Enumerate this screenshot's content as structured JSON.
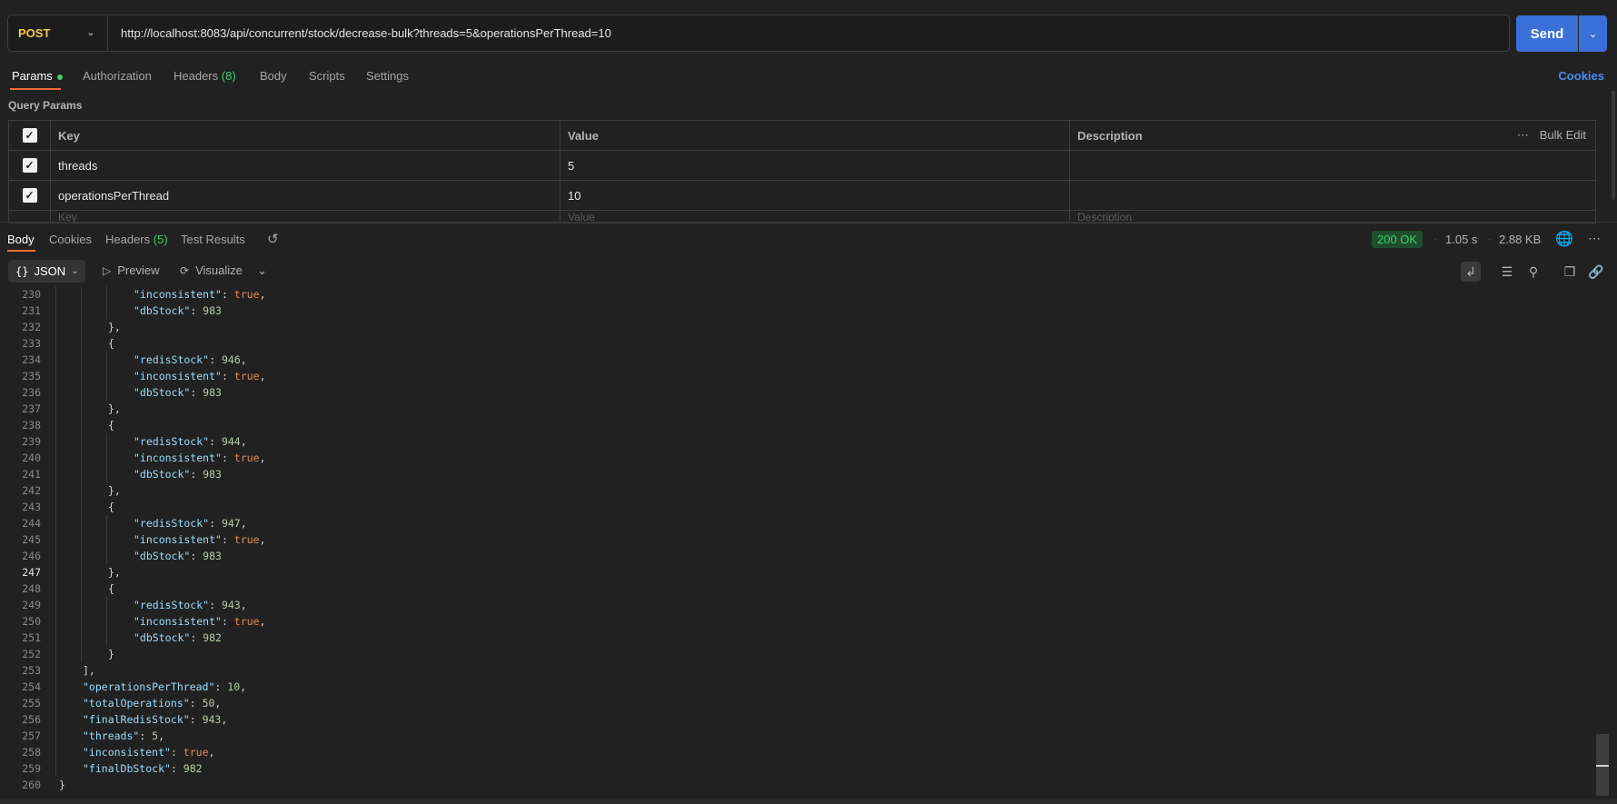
{
  "request": {
    "method": "POST",
    "url": "http://localhost:8083/api/concurrent/stock/decrease-bulk?threads=5&operationsPerThread=10",
    "send_label": "Send"
  },
  "request_tabs": {
    "params": "Params",
    "authorization": "Authorization",
    "headers": "Headers",
    "headers_count": "(8)",
    "body": "Body",
    "scripts": "Scripts",
    "settings": "Settings",
    "cookies": "Cookies"
  },
  "query_params": {
    "title": "Query Params",
    "headers": {
      "key": "Key",
      "value": "Value",
      "description": "Description",
      "bulk_edit": "Bulk Edit"
    },
    "rows": [
      {
        "key": "threads",
        "value": "5",
        "checked": true
      },
      {
        "key": "operationsPerThread",
        "value": "10",
        "checked": true
      }
    ],
    "placeholders": {
      "key": "Key",
      "value": "Value",
      "description": "Description"
    }
  },
  "response_tabs": {
    "body": "Body",
    "cookies": "Cookies",
    "headers": "Headers",
    "headers_count": "(5)",
    "test_results": "Test Results",
    "status": "200 OK",
    "time": "1.05 s",
    "size": "2.88 KB"
  },
  "response_toolbar": {
    "format": "JSON",
    "preview": "Preview",
    "visualize": "Visualize"
  },
  "colors": {
    "accent_orange": "#f26b3a",
    "send_blue": "#3b6fd8",
    "success_green": "#3ecf6e",
    "method_yellow": "#f2c94c"
  },
  "code_lines": [
    {
      "n": "230",
      "indent": 3,
      "parts": [
        [
          "k",
          "\"inconsistent\""
        ],
        [
          "p",
          ": "
        ],
        [
          "b",
          "true"
        ],
        [
          "p",
          ","
        ]
      ]
    },
    {
      "n": "231",
      "indent": 3,
      "parts": [
        [
          "k",
          "\"dbStock\""
        ],
        [
          "p",
          ": "
        ],
        [
          "n",
          "983"
        ]
      ]
    },
    {
      "n": "232",
      "indent": 2,
      "parts": [
        [
          "p",
          "},"
        ]
      ]
    },
    {
      "n": "233",
      "indent": 2,
      "parts": [
        [
          "p",
          "{"
        ]
      ]
    },
    {
      "n": "234",
      "indent": 3,
      "parts": [
        [
          "k",
          "\"redisStock\""
        ],
        [
          "p",
          ": "
        ],
        [
          "n",
          "946"
        ],
        [
          "p",
          ","
        ]
      ]
    },
    {
      "n": "235",
      "indent": 3,
      "parts": [
        [
          "k",
          "\"inconsistent\""
        ],
        [
          "p",
          ": "
        ],
        [
          "b",
          "true"
        ],
        [
          "p",
          ","
        ]
      ]
    },
    {
      "n": "236",
      "indent": 3,
      "parts": [
        [
          "k",
          "\"dbStock\""
        ],
        [
          "p",
          ": "
        ],
        [
          "n",
          "983"
        ]
      ]
    },
    {
      "n": "237",
      "indent": 2,
      "parts": [
        [
          "p",
          "},"
        ]
      ]
    },
    {
      "n": "238",
      "indent": 2,
      "parts": [
        [
          "p",
          "{"
        ]
      ]
    },
    {
      "n": "239",
      "indent": 3,
      "parts": [
        [
          "k",
          "\"redisStock\""
        ],
        [
          "p",
          ": "
        ],
        [
          "n",
          "944"
        ],
        [
          "p",
          ","
        ]
      ]
    },
    {
      "n": "240",
      "indent": 3,
      "parts": [
        [
          "k",
          "\"inconsistent\""
        ],
        [
          "p",
          ": "
        ],
        [
          "b",
          "true"
        ],
        [
          "p",
          ","
        ]
      ]
    },
    {
      "n": "241",
      "indent": 3,
      "parts": [
        [
          "k",
          "\"dbStock\""
        ],
        [
          "p",
          ": "
        ],
        [
          "n",
          "983"
        ]
      ]
    },
    {
      "n": "242",
      "indent": 2,
      "parts": [
        [
          "p",
          "},"
        ]
      ]
    },
    {
      "n": "243",
      "indent": 2,
      "parts": [
        [
          "p",
          "{"
        ]
      ]
    },
    {
      "n": "244",
      "indent": 3,
      "parts": [
        [
          "k",
          "\"redisStock\""
        ],
        [
          "p",
          ": "
        ],
        [
          "n",
          "947"
        ],
        [
          "p",
          ","
        ]
      ]
    },
    {
      "n": "245",
      "indent": 3,
      "parts": [
        [
          "k",
          "\"inconsistent\""
        ],
        [
          "p",
          ": "
        ],
        [
          "b",
          "true"
        ],
        [
          "p",
          ","
        ]
      ]
    },
    {
      "n": "246",
      "indent": 3,
      "parts": [
        [
          "k",
          "\"dbStock\""
        ],
        [
          "p",
          ": "
        ],
        [
          "n",
          "983"
        ]
      ]
    },
    {
      "n": "247",
      "indent": 2,
      "parts": [
        [
          "p",
          "},"
        ]
      ]
    },
    {
      "n": "248",
      "indent": 2,
      "parts": [
        [
          "p",
          "{"
        ]
      ]
    },
    {
      "n": "249",
      "indent": 3,
      "parts": [
        [
          "k",
          "\"redisStock\""
        ],
        [
          "p",
          ": "
        ],
        [
          "n",
          "943"
        ],
        [
          "p",
          ","
        ]
      ]
    },
    {
      "n": "250",
      "indent": 3,
      "parts": [
        [
          "k",
          "\"inconsistent\""
        ],
        [
          "p",
          ": "
        ],
        [
          "b",
          "true"
        ],
        [
          "p",
          ","
        ]
      ]
    },
    {
      "n": "251",
      "indent": 3,
      "parts": [
        [
          "k",
          "\"dbStock\""
        ],
        [
          "p",
          ": "
        ],
        [
          "n",
          "982"
        ]
      ]
    },
    {
      "n": "252",
      "indent": 2,
      "parts": [
        [
          "p",
          "}"
        ]
      ]
    },
    {
      "n": "253",
      "indent": 1,
      "parts": [
        [
          "p",
          "],"
        ]
      ]
    },
    {
      "n": "254",
      "indent": 1,
      "parts": [
        [
          "k",
          "\"operationsPerThread\""
        ],
        [
          "p",
          ": "
        ],
        [
          "n",
          "10"
        ],
        [
          "p",
          ","
        ]
      ]
    },
    {
      "n": "255",
      "indent": 1,
      "parts": [
        [
          "k",
          "\"totalOperations\""
        ],
        [
          "p",
          ": "
        ],
        [
          "n",
          "50"
        ],
        [
          "p",
          ","
        ]
      ]
    },
    {
      "n": "256",
      "indent": 1,
      "parts": [
        [
          "k",
          "\"finalRedisStock\""
        ],
        [
          "p",
          ": "
        ],
        [
          "n",
          "943"
        ],
        [
          "p",
          ","
        ]
      ]
    },
    {
      "n": "257",
      "indent": 1,
      "parts": [
        [
          "k",
          "\"threads\""
        ],
        [
          "p",
          ": "
        ],
        [
          "n",
          "5"
        ],
        [
          "p",
          ","
        ]
      ]
    },
    {
      "n": "258",
      "indent": 1,
      "parts": [
        [
          "k",
          "\"inconsistent\""
        ],
        [
          "p",
          ": "
        ],
        [
          "b",
          "true"
        ],
        [
          "p",
          ","
        ]
      ]
    },
    {
      "n": "259",
      "indent": 1,
      "parts": [
        [
          "k",
          "\"finalDbStock\""
        ],
        [
          "p",
          ": "
        ],
        [
          "n",
          "982"
        ]
      ]
    },
    {
      "n": "260",
      "indent": 0,
      "parts": [
        [
          "p",
          "}"
        ]
      ]
    }
  ],
  "current_line": "247"
}
